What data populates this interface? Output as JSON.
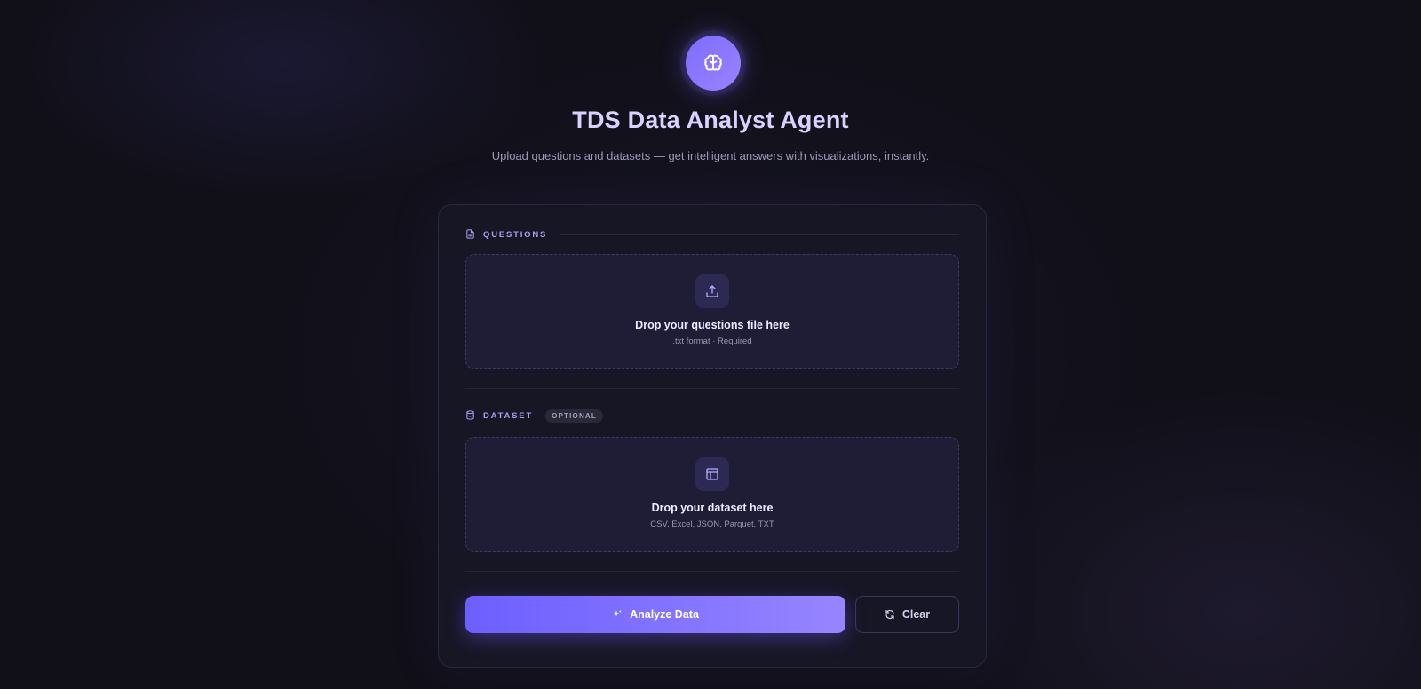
{
  "header": {
    "title": "TDS Data Analyst Agent",
    "subtitle": "Upload questions and datasets — get intelligent answers with visualizations, instantly.",
    "logo_icon": "brain-icon"
  },
  "questions": {
    "section_label": "QUESTIONS",
    "section_icon": "file-text-icon",
    "drop_icon": "upload-icon",
    "drop_title": "Drop your questions file here",
    "drop_hint": ".txt format · Required"
  },
  "dataset": {
    "section_label": "DATASET",
    "section_icon": "database-icon",
    "badge": "OPTIONAL",
    "drop_icon": "table-icon",
    "drop_title": "Drop your dataset here",
    "drop_hint": "CSV, Excel, JSON, Parquet, TXT"
  },
  "actions": {
    "analyze_label": "Analyze Data",
    "analyze_icon": "sparkles-icon",
    "clear_label": "Clear",
    "clear_icon": "refresh-icon"
  },
  "colors": {
    "accent": "#7c6cff",
    "accent_light": "#9785ff",
    "background": "#111019",
    "card": "#171625",
    "dropzone": "#1e1d35"
  }
}
